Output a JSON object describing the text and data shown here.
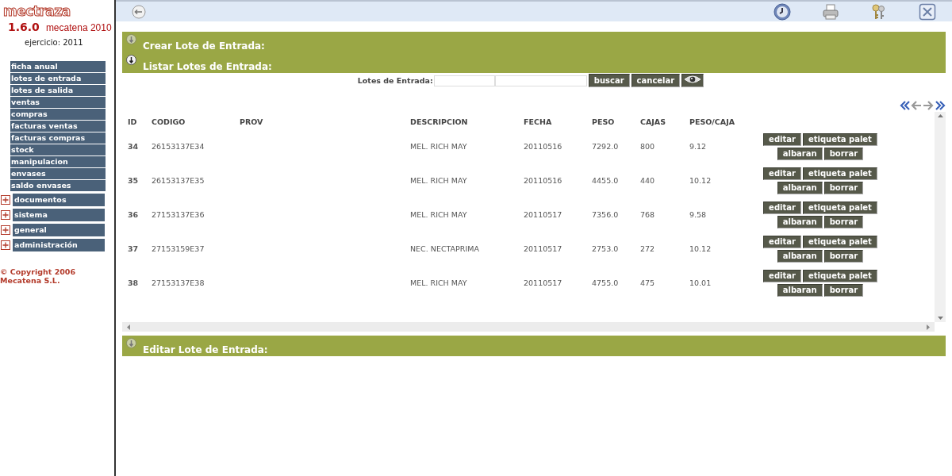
{
  "app": {
    "logo": "mectraza",
    "version": "1.6.0",
    "brand": "mecatena 2010",
    "exercise": "ejercicio: 2011"
  },
  "sidebar": {
    "items": [
      {
        "label": "ficha anual",
        "kind": "link"
      },
      {
        "label": "lotes de entrada",
        "kind": "link"
      },
      {
        "label": "lotes de salida",
        "kind": "link"
      },
      {
        "label": "ventas",
        "kind": "link"
      },
      {
        "label": "compras",
        "kind": "link"
      },
      {
        "label": "facturas ventas",
        "kind": "link"
      },
      {
        "label": "facturas compras",
        "kind": "link"
      },
      {
        "label": "stock",
        "kind": "link"
      },
      {
        "label": "manipulacion",
        "kind": "link"
      },
      {
        "label": "envases",
        "kind": "link"
      },
      {
        "label": "saldo envases",
        "kind": "link"
      },
      {
        "label": "documentos",
        "kind": "group",
        "expanded": false
      },
      {
        "label": "sistema",
        "kind": "group",
        "expanded": false
      },
      {
        "label": "general",
        "kind": "group",
        "expanded": false
      },
      {
        "label": "administración",
        "kind": "group",
        "expanded": false
      }
    ],
    "copyright": [
      "© Copyright 2006",
      "Mecatena S.L."
    ]
  },
  "panels": [
    {
      "title": "Crear Lote de Entrada:",
      "expanded": false
    },
    {
      "title": "Listar Lotes de Entrada:",
      "expanded": true
    },
    {
      "title": "Editar Lote de Entrada:",
      "expanded": false
    }
  ],
  "list": {
    "search": {
      "label": "Lotes de Entrada:",
      "buttons": [
        "buscar",
        "cancelar"
      ]
    },
    "table": {
      "columns": [
        "ID",
        "CODIGO",
        "PROV",
        "DESCRIPCION",
        "FECHA",
        "PESO",
        "CAJAS",
        "PESO/CAJA"
      ],
      "rows": [
        {
          "cells": [
            "34",
            "26153137E34",
            "",
            "MEL. RICH MAY",
            "20110516",
            "7292.0",
            "800",
            "9.12"
          ],
          "actions": [
            "editar",
            "etiqueta palet",
            "albaran",
            "borrar"
          ]
        },
        {
          "cells": [
            "35",
            "26153137E35",
            "",
            "MEL. RICH MAY",
            "20110516",
            "4455.0",
            "440",
            "10.12"
          ],
          "actions": [
            "editar",
            "etiqueta palet",
            "albaran",
            "borrar"
          ]
        },
        {
          "cells": [
            "36",
            "27153137E36",
            "",
            "MEL. RICH MAY",
            "20110517",
            "7356.0",
            "768",
            "9.58"
          ],
          "actions": [
            "editar",
            "etiqueta palet",
            "albaran",
            "borrar"
          ]
        },
        {
          "cells": [
            "37",
            "27153159E37",
            "",
            "NEC. NECTAPRIMA",
            "20110517",
            "2753.0",
            "272",
            "10.12"
          ],
          "actions": [
            "editar",
            "etiqueta palet",
            "albaran",
            "borrar"
          ]
        },
        {
          "cells": [
            "38",
            "27153137E38",
            "",
            "MEL. RICH MAY",
            "20110517",
            "4755.0",
            "475",
            "10.01"
          ],
          "actions": [
            "editar",
            "etiqueta palet",
            "albaran",
            "borrar"
          ]
        }
      ]
    }
  }
}
